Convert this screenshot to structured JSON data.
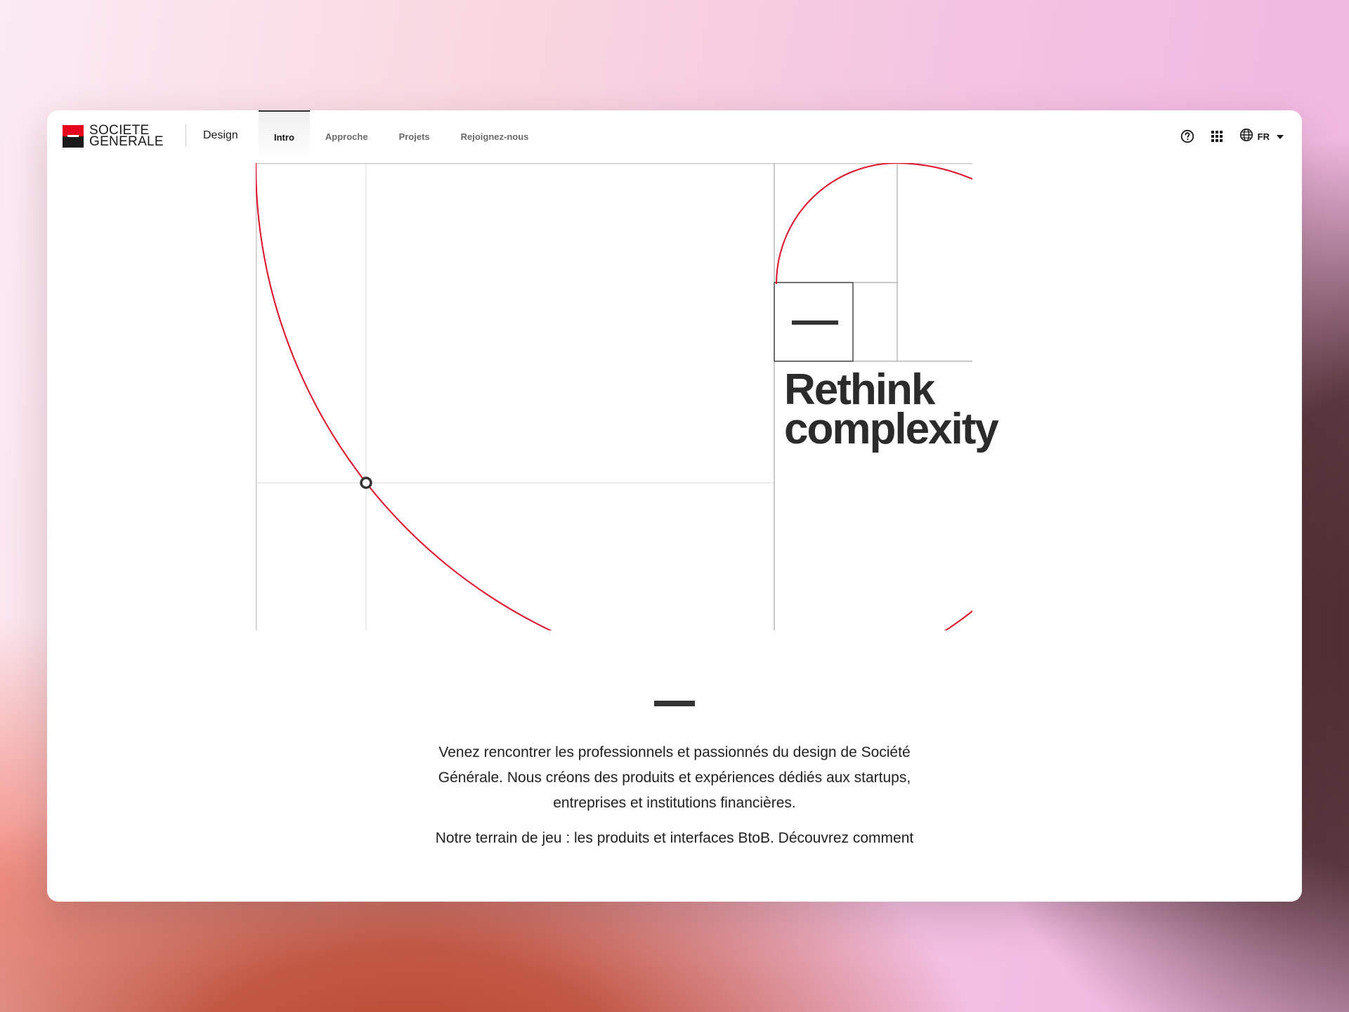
{
  "brand": {
    "logo_line1": "SOCIETE",
    "logo_line2": "GENERALE",
    "section": "Design"
  },
  "nav": {
    "items": [
      {
        "label": "Intro",
        "active": true
      },
      {
        "label": "Approche",
        "active": false
      },
      {
        "label": "Projets",
        "active": false
      },
      {
        "label": "Rejoignez-nous",
        "active": false
      }
    ]
  },
  "header_actions": {
    "help_icon": "help-circle-icon",
    "apps_icon": "grid-icon",
    "language_icon": "globe-icon",
    "language": "FR",
    "dropdown_icon": "caret-down-icon"
  },
  "hero": {
    "tagline_line1": "Rethink",
    "tagline_line2": "complexity"
  },
  "intro": {
    "paragraph1": "Venez rencontrer les professionnels et passionnés du design de Société Générale. Nous créons des produits et expériences dédiés aux startups, entreprises et institutions financières.",
    "paragraph2": "Notre terrain de jeu : les produits et interfaces BtoB. Découvrez comment"
  },
  "colors": {
    "brand_red": "#e9041e",
    "brand_black": "#1a1a1a",
    "spiral": "#e0102a"
  }
}
